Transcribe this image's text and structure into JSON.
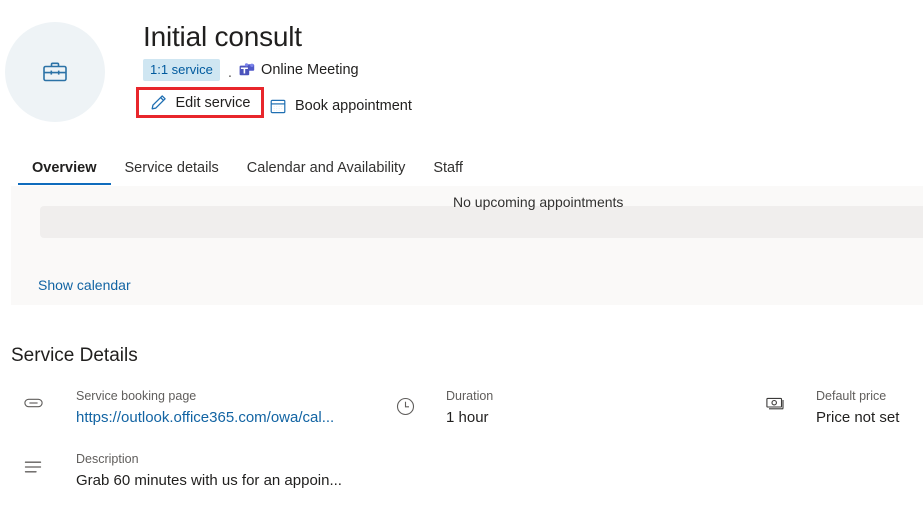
{
  "header": {
    "avatar_icon": "briefcase-icon",
    "title": "Initial consult",
    "badge": "1:1 service",
    "separator": ".",
    "meeting_type": "Online Meeting",
    "meeting_icon": "microsoft-teams-icon",
    "edit_service_label": "Edit service",
    "edit_service_icon": "pencil-icon",
    "book_appointment_label": "Book appointment",
    "book_appointment_icon": "calendar-icon",
    "highlight_color": "#e8262b"
  },
  "tabs": [
    {
      "label": "Overview",
      "active": true
    },
    {
      "label": "Service details",
      "active": false
    },
    {
      "label": "Calendar and Availability",
      "active": false
    },
    {
      "label": "Staff",
      "active": false
    }
  ],
  "appointments": {
    "empty_text": "No upcoming appointments",
    "show_calendar_label": "Show calendar"
  },
  "service_details": {
    "title": "Service Details",
    "columns": [
      {
        "items": [
          {
            "icon": "link-icon",
            "label": "Service booking page",
            "value": "https://outlook.office365.com/owa/cal...",
            "is_link": true
          },
          {
            "icon": "description-lines-icon",
            "label": "Description",
            "value": "Grab 60 minutes with us for an appoin...",
            "is_link": false
          }
        ]
      },
      {
        "items": [
          {
            "icon": "clock-icon",
            "label": "Duration",
            "value": "1 hour",
            "is_link": false
          }
        ]
      },
      {
        "items": [
          {
            "icon": "money-icon",
            "label": "Default price",
            "value": "Price not set",
            "is_link": false
          }
        ]
      }
    ]
  },
  "colors": {
    "accent": "#0f6cbd",
    "link": "#1264a3",
    "badge_bg": "#cfe6f2",
    "badge_fg": "#005a9e",
    "panel_bg": "#faf9f8",
    "empty_bg": "#f0eeed"
  }
}
